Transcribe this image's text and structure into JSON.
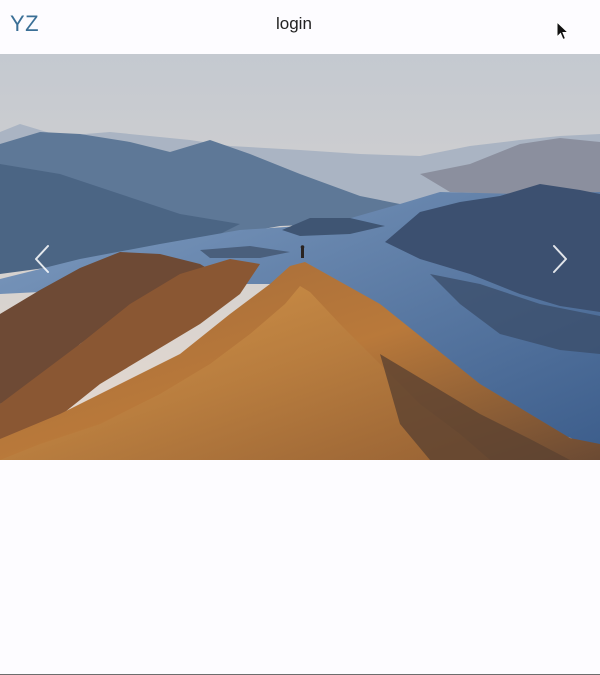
{
  "navbar": {
    "brand": "YZ",
    "login_label": "login"
  },
  "carousel": {
    "image_icon": "landscape-photo-icon",
    "prev_icon": "chevron-left-icon",
    "next_icon": "chevron-right-icon"
  },
  "colors": {
    "brand": "#3a6f96",
    "background": "#fdfcff",
    "text": "#222222"
  }
}
